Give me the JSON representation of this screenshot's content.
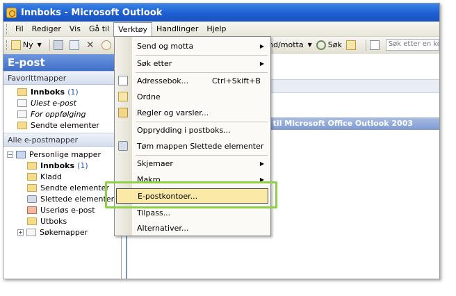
{
  "window": {
    "title": "Innboks - Microsoft Outlook"
  },
  "menubar": [
    "Fil",
    "Rediger",
    "Vis",
    "Gå til",
    "Verktøy",
    "Handlinger",
    "Hjelp"
  ],
  "toolbar": {
    "new_label": "Ny",
    "sendrecv_label": "Send/motta",
    "find_label": "Søk",
    "search_placeholder": "Søk etter en ko"
  },
  "nav": {
    "header": "E-post",
    "favorites_header": "Favorittmapper",
    "favorites": [
      {
        "label": "Innboks",
        "count": "(1)",
        "style": "bold"
      },
      {
        "label": "Ulest e-post",
        "style": "italic"
      },
      {
        "label": "For oppfølging",
        "style": "italic"
      },
      {
        "label": "Sendte elementer",
        "style": "normal"
      }
    ],
    "all_header": "Alle e-postmapper",
    "personal_root": "Personlige mapper",
    "folders": [
      {
        "label": "Innboks",
        "count": "(1)",
        "style": "bold"
      },
      {
        "label": "Kladd"
      },
      {
        "label": "Sendte elementer"
      },
      {
        "label": "Slettede elementer"
      },
      {
        "label": "Useriøs e-post"
      },
      {
        "label": "Utboks"
      },
      {
        "label": "Søkemapper"
      }
    ]
  },
  "content": {
    "welcome_fragment": "n til Microsoft Office Outlook 2003"
  },
  "tools_menu": {
    "items": [
      {
        "label": "Send og motta",
        "submenu": true
      },
      {
        "label": "Søk etter",
        "submenu": true
      },
      {
        "label": "Adressebok...",
        "shortcut": "Ctrl+Skift+B"
      },
      {
        "label": "Ordne"
      },
      {
        "label": "Regler og varsler..."
      },
      {
        "label": "Opprydding i postboks..."
      },
      {
        "label": "Tøm mappen Slettede elementer"
      },
      {
        "label": "Skjemaer",
        "submenu": true
      },
      {
        "label": "Makro",
        "submenu": true
      },
      {
        "label": "E-postkontoer...",
        "selected": true
      },
      {
        "label": "Tilpass..."
      },
      {
        "label": "Alternativer..."
      }
    ]
  },
  "colors": {
    "highlight_box": "#8ed047",
    "selected_item_bg": "#fbe9a8",
    "title_bar": "#1d5fd1"
  }
}
